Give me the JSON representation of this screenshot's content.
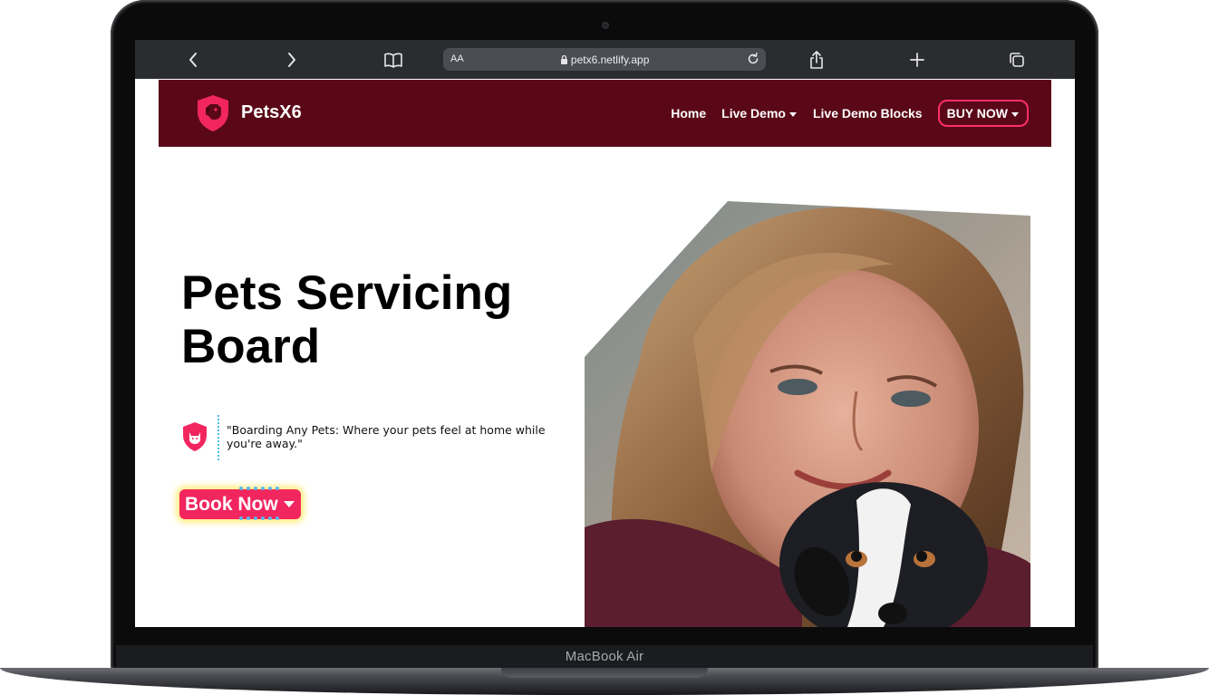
{
  "device": {
    "model_label": "MacBook Air"
  },
  "browser": {
    "text_size_label": "AA",
    "url": "petx6.netlify.app",
    "icons": [
      "back-icon",
      "forward-icon",
      "reader-icon",
      "lock-icon",
      "reload-icon",
      "share-icon",
      "new-tab-icon",
      "tabs-icon"
    ]
  },
  "site": {
    "brand": "PetsX6",
    "nav": {
      "home": "Home",
      "live_demo": "Live Demo",
      "live_demo_blocks": "Live Demo Blocks",
      "buy_now": "BUY NOW"
    },
    "hero": {
      "title_line1": "Pets Servicing",
      "title_line2": "Board",
      "quote": "\"Boarding Any Pets: Where your pets feel at home while you're away.\"",
      "cta": "Book Now"
    },
    "colors": {
      "header_bg": "#5a0817",
      "accent": "#f2265f",
      "text": "#000000"
    }
  }
}
